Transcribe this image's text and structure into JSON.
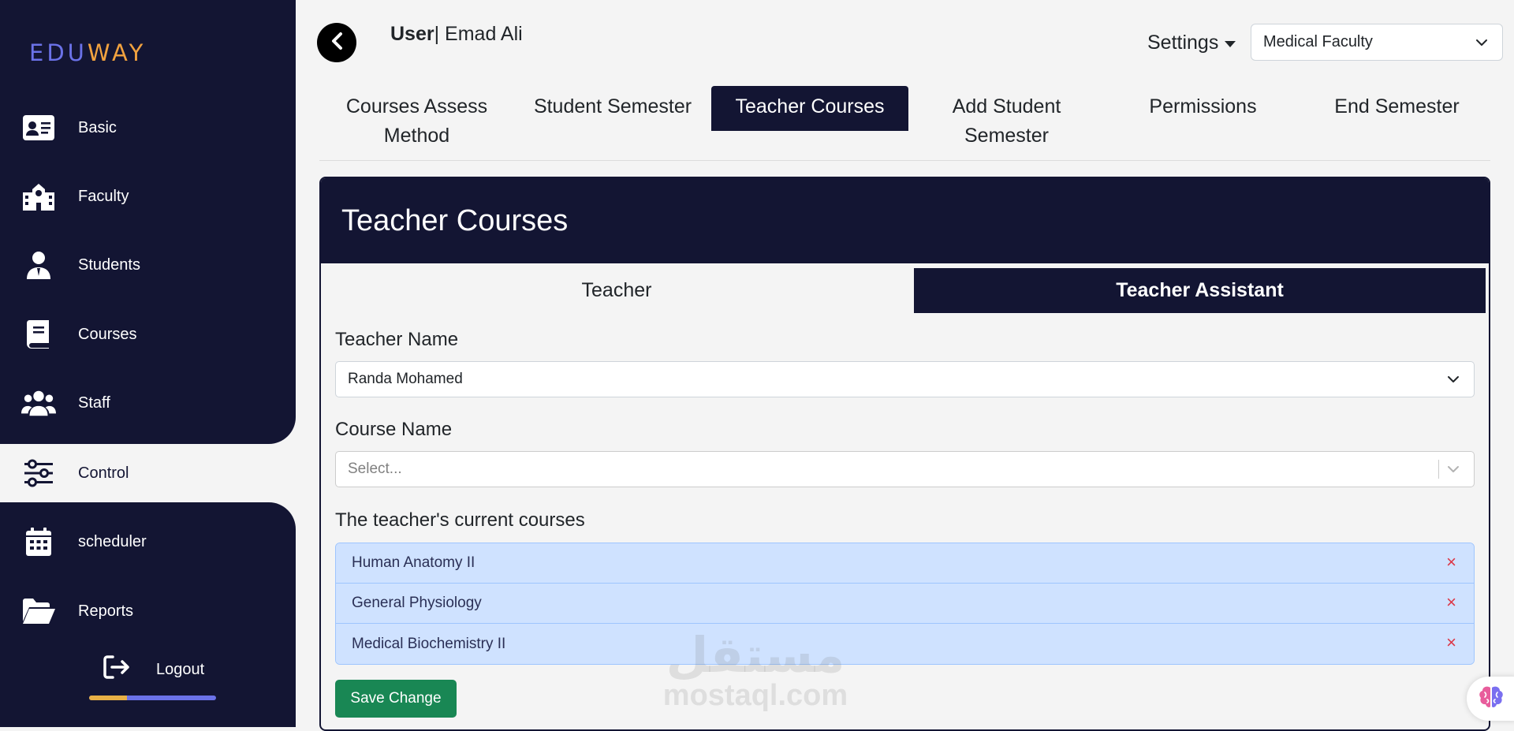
{
  "brand": {
    "part1": "EDU",
    "part2": "WAY"
  },
  "sidebar": {
    "items": [
      {
        "label": "Basic",
        "icon": "id-card-icon"
      },
      {
        "label": "Faculty",
        "icon": "school-icon"
      },
      {
        "label": "Students",
        "icon": "student-icon"
      },
      {
        "label": "Courses",
        "icon": "book-icon"
      },
      {
        "label": "Staff",
        "icon": "users-icon"
      },
      {
        "label": "Control",
        "icon": "sliders-icon",
        "active": true
      },
      {
        "label": "scheduler",
        "icon": "calendar-icon"
      },
      {
        "label": "Reports",
        "icon": "folder-open-icon"
      }
    ],
    "logout": {
      "label": "Logout",
      "icon": "logout-icon",
      "progress": 0.3
    }
  },
  "header": {
    "user_label": "User",
    "user_name": "| Emad Ali",
    "settings_label": "Settings",
    "faculty_select": "Medical Faculty"
  },
  "tabs": [
    {
      "label": "Courses Assess Method"
    },
    {
      "label": "Student Semester"
    },
    {
      "label": "Teacher Courses",
      "active": true
    },
    {
      "label": "Add Student Semester"
    },
    {
      "label": "Permissions"
    },
    {
      "label": "End Semester"
    }
  ],
  "card": {
    "title": "Teacher Courses",
    "sub_tabs": [
      {
        "label": "Teacher"
      },
      {
        "label": "Teacher Assistant",
        "active": true
      }
    ],
    "teacher_name_label": "Teacher Name",
    "teacher_name_value": "Randa Mohamed",
    "course_name_label": "Course Name",
    "course_name_placeholder": "Select...",
    "current_courses_label": "The teacher's current courses",
    "current_courses": [
      "Human Anatomy II",
      "General Physiology",
      "Medical Biochemistry II"
    ],
    "remove_symbol": "×",
    "save_label": "Save Change"
  },
  "watermark": {
    "arabic": "مستقل",
    "latin": "mostaql.com"
  },
  "colors": {
    "sidebar_bg": "#131533",
    "brand_edu": "#6b72e8",
    "brand_way": "#f1a23f",
    "course_item_bg": "#cfe2ff",
    "save_button": "#198754",
    "remove_icon": "#dc3545"
  }
}
